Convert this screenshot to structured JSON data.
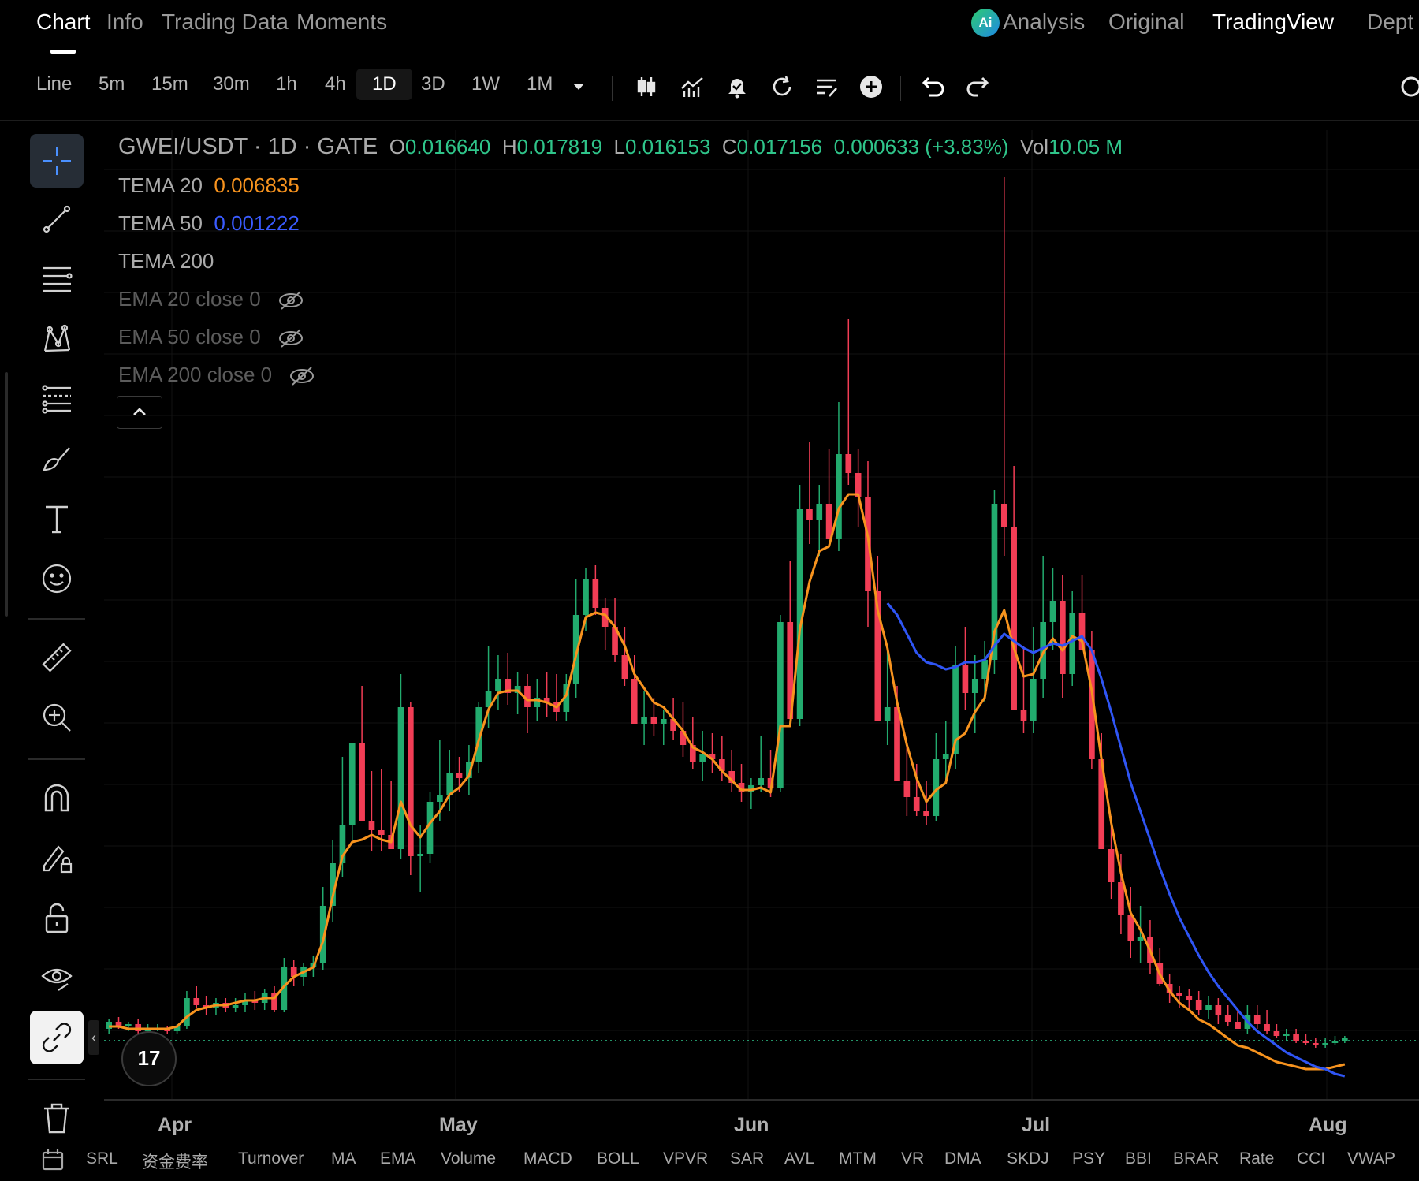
{
  "top_tabs": {
    "chart": "Chart",
    "info": "Info",
    "trading_data": "Trading Data",
    "moments": "Moments",
    "analysis": "Analysis",
    "original": "Original",
    "tradingview": "TradingView",
    "depth": "Dept"
  },
  "ai_badge": "Ai",
  "toolbar": {
    "timeframes": [
      "Line",
      "5m",
      "15m",
      "30m",
      "1h",
      "4h",
      "1D",
      "3D",
      "1W",
      "1M"
    ],
    "active_timeframe": "1D",
    "icons": [
      "candlestick-type-icon",
      "indicators-icon",
      "alert-icon",
      "replay-icon",
      "templates-icon",
      "add-icon",
      "undo-icon",
      "redo-icon",
      "settings-icon"
    ]
  },
  "legend": {
    "symbol": "GWEI/USDT · 1D · GATE",
    "o_label": "O",
    "o_value": "0.016640",
    "h_label": "H",
    "h_value": "0.017819",
    "l_label": "L",
    "l_value": "0.016153",
    "c_label": "C",
    "c_value": "0.017156",
    "change": "0.000633 (+3.83%)",
    "vol_label": "Vol",
    "vol_value": "10.05 M",
    "tema20_label": "TEMA 20",
    "tema20_value": "0.006835",
    "tema50_label": "TEMA 50",
    "tema50_value": "0.001222",
    "tema200_label": "TEMA 200",
    "ema20_label": "EMA 20 close 0",
    "ema50_label": "EMA 50 close 0",
    "ema200_label": "EMA 200 close 0"
  },
  "left_tools": [
    "crosshair-icon",
    "trend-line-icon",
    "horizontal-lines-icon",
    "pattern-icon",
    "fib-icon",
    "brush-icon",
    "text-icon",
    "emoji-icon",
    "ruler-icon",
    "zoom-in-icon",
    "magnet-icon",
    "lock-drawing-icon",
    "unlock-icon",
    "eye-icon",
    "link-icon",
    "trash-icon"
  ],
  "colors": {
    "up": "#22ab6e",
    "down": "#f23d55",
    "tema20": "#f7931e",
    "tema50": "#2f55f4",
    "background": "#000000"
  },
  "x_axis_labels": [
    "Apr",
    "May",
    "Jun",
    "Jul",
    "Aug"
  ],
  "tv_logo": "17",
  "side_toggle": "‹",
  "bottom_indicators": [
    "SRL",
    "资金费率",
    "Turnover",
    "MA",
    "EMA",
    "Volume",
    "MACD",
    "BOLL",
    "VPVR",
    "SAR",
    "AVL",
    "MTM",
    "VR",
    "DMA",
    "SKDJ",
    "PSY",
    "BBI",
    "BRAR",
    "Rate",
    "CCI",
    "VWAP"
  ],
  "chart_data": {
    "type": "candlestick",
    "series_note": "approximate",
    "candles": [
      [
        0.01,
        0.0104,
        0.0098,
        0.0103
      ],
      [
        0.0103,
        0.0105,
        0.01,
        0.0101
      ],
      [
        0.0101,
        0.0103,
        0.0099,
        0.0102
      ],
      [
        0.0102,
        0.0104,
        0.0098,
        0.0099
      ],
      [
        0.0099,
        0.0102,
        0.0098,
        0.01
      ],
      [
        0.01,
        0.0102,
        0.0099,
        0.01
      ],
      [
        0.01,
        0.0101,
        0.0098,
        0.0099
      ],
      [
        0.0099,
        0.0102,
        0.0098,
        0.0101
      ],
      [
        0.0101,
        0.0116,
        0.01,
        0.0113
      ],
      [
        0.0113,
        0.0118,
        0.0109,
        0.011
      ],
      [
        0.011,
        0.0114,
        0.0106,
        0.0109
      ],
      [
        0.0109,
        0.0113,
        0.0106,
        0.0111
      ],
      [
        0.0111,
        0.0113,
        0.0107,
        0.0109
      ],
      [
        0.0109,
        0.0113,
        0.0107,
        0.011
      ],
      [
        0.011,
        0.0115,
        0.0107,
        0.0112
      ],
      [
        0.0112,
        0.0116,
        0.0108,
        0.0111
      ],
      [
        0.0111,
        0.0117,
        0.0108,
        0.0115
      ],
      [
        0.0115,
        0.0118,
        0.0107,
        0.0108
      ],
      [
        0.0108,
        0.013,
        0.0107,
        0.0126
      ],
      [
        0.0126,
        0.0129,
        0.0118,
        0.0122
      ],
      [
        0.0122,
        0.0128,
        0.0118,
        0.0126
      ],
      [
        0.0126,
        0.0131,
        0.0122,
        0.0128
      ],
      [
        0.0128,
        0.016,
        0.0125,
        0.0152
      ],
      [
        0.0152,
        0.018,
        0.0145,
        0.017
      ],
      [
        0.017,
        0.0215,
        0.0164,
        0.0186
      ],
      [
        0.0186,
        0.0207,
        0.018,
        0.0221
      ],
      [
        0.0221,
        0.0245,
        0.02,
        0.0188
      ],
      [
        0.0188,
        0.0209,
        0.0175,
        0.0184
      ],
      [
        0.0184,
        0.021,
        0.0175,
        0.0182
      ],
      [
        0.0182,
        0.0205,
        0.0176,
        0.0176
      ],
      [
        0.0176,
        0.025,
        0.0172,
        0.0236
      ],
      [
        0.0236,
        0.0238,
        0.0165,
        0.0173
      ],
      [
        0.0173,
        0.0186,
        0.0158,
        0.0174
      ],
      [
        0.0174,
        0.02,
        0.017,
        0.0196
      ],
      [
        0.0196,
        0.0222,
        0.0188,
        0.0199
      ],
      [
        0.0199,
        0.0218,
        0.0192,
        0.0208
      ],
      [
        0.0208,
        0.0215,
        0.02,
        0.0206
      ],
      [
        0.0206,
        0.022,
        0.0199,
        0.0213
      ],
      [
        0.0213,
        0.0238,
        0.0208,
        0.0236
      ],
      [
        0.0236,
        0.0262,
        0.0227,
        0.0243
      ],
      [
        0.0243,
        0.0258,
        0.0235,
        0.0248
      ],
      [
        0.0248,
        0.0259,
        0.0237,
        0.0242
      ],
      [
        0.0242,
        0.0251,
        0.0233,
        0.0245
      ],
      [
        0.0245,
        0.025,
        0.0225,
        0.0236
      ],
      [
        0.0236,
        0.0248,
        0.023,
        0.024
      ],
      [
        0.024,
        0.0251,
        0.0232,
        0.0238
      ],
      [
        0.0238,
        0.025,
        0.023,
        0.0234
      ],
      [
        0.0234,
        0.025,
        0.023,
        0.0246
      ],
      [
        0.0246,
        0.029,
        0.024,
        0.0275
      ],
      [
        0.0275,
        0.0295,
        0.0268,
        0.029
      ],
      [
        0.029,
        0.0296,
        0.0275,
        0.0278
      ],
      [
        0.0278,
        0.0282,
        0.026,
        0.027
      ],
      [
        0.027,
        0.0282,
        0.0255,
        0.0258
      ],
      [
        0.0258,
        0.027,
        0.0245,
        0.0248
      ],
      [
        0.0248,
        0.0258,
        0.0235,
        0.0229
      ],
      [
        0.0229,
        0.0243,
        0.022,
        0.0232
      ],
      [
        0.0232,
        0.024,
        0.0224,
        0.0229
      ],
      [
        0.0229,
        0.0235,
        0.022,
        0.0231
      ],
      [
        0.0231,
        0.024,
        0.0222,
        0.0226
      ],
      [
        0.0226,
        0.0238,
        0.0215,
        0.022
      ],
      [
        0.022,
        0.0232,
        0.021,
        0.0213
      ],
      [
        0.0213,
        0.0226,
        0.0205,
        0.0216
      ],
      [
        0.0216,
        0.0225,
        0.0208,
        0.0214
      ],
      [
        0.0214,
        0.0224,
        0.0205,
        0.0209
      ],
      [
        0.0209,
        0.0218,
        0.02,
        0.0204
      ],
      [
        0.0204,
        0.0212,
        0.0196,
        0.02
      ],
      [
        0.02,
        0.0206,
        0.0193,
        0.0203
      ],
      [
        0.0203,
        0.0224,
        0.02,
        0.0206
      ],
      [
        0.0206,
        0.0218,
        0.0198,
        0.0202
      ],
      [
        0.0202,
        0.0275,
        0.02,
        0.0272
      ],
      [
        0.0272,
        0.0298,
        0.0265,
        0.0231
      ],
      [
        0.0231,
        0.033,
        0.0228,
        0.032
      ],
      [
        0.032,
        0.0348,
        0.0305,
        0.0315
      ],
      [
        0.0315,
        0.033,
        0.03,
        0.0322
      ],
      [
        0.0322,
        0.0345,
        0.0309,
        0.0307
      ],
      [
        0.0307,
        0.0365,
        0.0302,
        0.0343
      ],
      [
        0.0343,
        0.04,
        0.033,
        0.0335
      ],
      [
        0.0335,
        0.0345,
        0.0312,
        0.0325
      ],
      [
        0.0325,
        0.034,
        0.027,
        0.0285
      ],
      [
        0.0285,
        0.03,
        0.024,
        0.023
      ],
      [
        0.023,
        0.0262,
        0.022,
        0.0236
      ],
      [
        0.0236,
        0.0245,
        0.0215,
        0.0205
      ],
      [
        0.0205,
        0.022,
        0.019,
        0.0198
      ],
      [
        0.0198,
        0.0212,
        0.019,
        0.0192
      ],
      [
        0.0192,
        0.0205,
        0.0186,
        0.019
      ],
      [
        0.019,
        0.0225,
        0.0188,
        0.0214
      ],
      [
        0.0214,
        0.023,
        0.0205,
        0.0216
      ],
      [
        0.0216,
        0.0262,
        0.021,
        0.0254
      ],
      [
        0.0254,
        0.027,
        0.0235,
        0.0242
      ],
      [
        0.0242,
        0.0258,
        0.0225,
        0.0248
      ],
      [
        0.0248,
        0.0264,
        0.0238,
        0.0256
      ],
      [
        0.0256,
        0.0328,
        0.025,
        0.0322
      ],
      [
        0.0322,
        0.046,
        0.03,
        0.0312
      ],
      [
        0.0312,
        0.0338,
        0.027,
        0.0235
      ],
      [
        0.0235,
        0.0262,
        0.0225,
        0.023
      ],
      [
        0.023,
        0.027,
        0.0225,
        0.0248
      ],
      [
        0.0248,
        0.03,
        0.024,
        0.0272
      ],
      [
        0.0272,
        0.0295,
        0.026,
        0.0281
      ],
      [
        0.0281,
        0.0292,
        0.024,
        0.025
      ],
      [
        0.025,
        0.0285,
        0.0245,
        0.0276
      ],
      [
        0.0276,
        0.0292,
        0.0262,
        0.026
      ],
      [
        0.026,
        0.0268,
        0.021,
        0.0214
      ],
      [
        0.0214,
        0.0225,
        0.018,
        0.0176
      ],
      [
        0.0176,
        0.019,
        0.0155,
        0.0162
      ],
      [
        0.0162,
        0.0174,
        0.014,
        0.0148
      ],
      [
        0.0148,
        0.016,
        0.013,
        0.0137
      ],
      [
        0.0137,
        0.0152,
        0.0128,
        0.0139
      ],
      [
        0.0139,
        0.0146,
        0.0123,
        0.0128
      ],
      [
        0.0128,
        0.0134,
        0.0118,
        0.0119
      ],
      [
        0.0119,
        0.0123,
        0.0111,
        0.0115
      ],
      [
        0.0115,
        0.0118,
        0.0109,
        0.0114
      ],
      [
        0.0114,
        0.0117,
        0.0108,
        0.0112
      ],
      [
        0.0112,
        0.0116,
        0.0106,
        0.0108
      ],
      [
        0.0108,
        0.0114,
        0.0104,
        0.011
      ],
      [
        0.011,
        0.0113,
        0.0102,
        0.0106
      ],
      [
        0.0106,
        0.011,
        0.0101,
        0.0103
      ],
      [
        0.0103,
        0.0108,
        0.01,
        0.01
      ],
      [
        0.01,
        0.011,
        0.0098,
        0.0106
      ],
      [
        0.0106,
        0.011,
        0.01,
        0.0102
      ],
      [
        0.0102,
        0.0108,
        0.0098,
        0.0099
      ],
      [
        0.0099,
        0.0102,
        0.0096,
        0.0097
      ],
      [
        0.0097,
        0.01,
        0.0095,
        0.0098
      ],
      [
        0.0098,
        0.01,
        0.0094,
        0.0095
      ],
      [
        0.0095,
        0.0098,
        0.0093,
        0.0094
      ],
      [
        0.0094,
        0.0096,
        0.0092,
        0.0093
      ],
      [
        0.0093,
        0.0096,
        0.0092,
        0.0094
      ],
      [
        0.0094,
        0.0097,
        0.0093,
        0.0095
      ],
      [
        0.0095,
        0.0097,
        0.0094,
        0.0096
      ]
    ],
    "tema20": [
      0.0101,
      0.0101,
      0.01,
      0.01,
      0.01,
      0.01,
      0.01,
      0.0101,
      0.0105,
      0.0108,
      0.0109,
      0.011,
      0.011,
      0.0111,
      0.0112,
      0.0112,
      0.0113,
      0.0113,
      0.0118,
      0.0122,
      0.0124,
      0.0126,
      0.0137,
      0.0156,
      0.0173,
      0.0179,
      0.018,
      0.0182,
      0.018,
      0.0179,
      0.0196,
      0.0186,
      0.0181,
      0.0187,
      0.0192,
      0.0199,
      0.0202,
      0.0207,
      0.0222,
      0.0235,
      0.0242,
      0.0243,
      0.0243,
      0.0239,
      0.0239,
      0.0238,
      0.0236,
      0.0241,
      0.0258,
      0.0274,
      0.0276,
      0.0275,
      0.027,
      0.0262,
      0.025,
      0.0244,
      0.0238,
      0.0236,
      0.0231,
      0.0226,
      0.0219,
      0.0217,
      0.0214,
      0.0209,
      0.0205,
      0.0201,
      0.0201,
      0.0202,
      0.02,
      0.0228,
      0.0228,
      0.0269,
      0.0289,
      0.0302,
      0.0304,
      0.032,
      0.0326,
      0.0326,
      0.0308,
      0.0277,
      0.0261,
      0.0238,
      0.022,
      0.0206,
      0.0196,
      0.0201,
      0.0204,
      0.0222,
      0.0225,
      0.0234,
      0.024,
      0.0268,
      0.0277,
      0.0261,
      0.0249,
      0.025,
      0.0259,
      0.0265,
      0.026,
      0.0266,
      0.0264,
      0.0243,
      0.0214,
      0.0187,
      0.0166,
      0.0149,
      0.0142,
      0.0133,
      0.0123,
      0.0116,
      0.0111,
      0.0108,
      0.0104,
      0.0102,
      0.0099,
      0.0096,
      0.0093,
      0.0092,
      0.009,
      0.0088,
      0.0086,
      0.0085,
      0.0084,
      0.0083,
      0.0083,
      0.0083,
      0.0084,
      0.0085
    ],
    "tema50_start_index": 80,
    "tema50": [
      0.028,
      0.0275,
      0.0267,
      0.0259,
      0.0255,
      0.0254,
      0.0252,
      0.0253,
      0.0255,
      0.0255,
      0.0256,
      0.0262,
      0.0267,
      0.0264,
      0.0261,
      0.0259,
      0.0261,
      0.0263,
      0.0262,
      0.0264,
      0.0266,
      0.026,
      0.0248,
      0.0234,
      0.0219,
      0.0204,
      0.0192,
      0.018,
      0.0168,
      0.0157,
      0.0147,
      0.0139,
      0.0131,
      0.0124,
      0.0118,
      0.0113,
      0.0108,
      0.0103,
      0.0099,
      0.0096,
      0.0093,
      0.009,
      0.0088,
      0.0086,
      0.0084,
      0.0083,
      0.0081,
      0.008
    ],
    "last_price": 0.0095,
    "ylim": [
      0.007,
      0.048
    ]
  }
}
